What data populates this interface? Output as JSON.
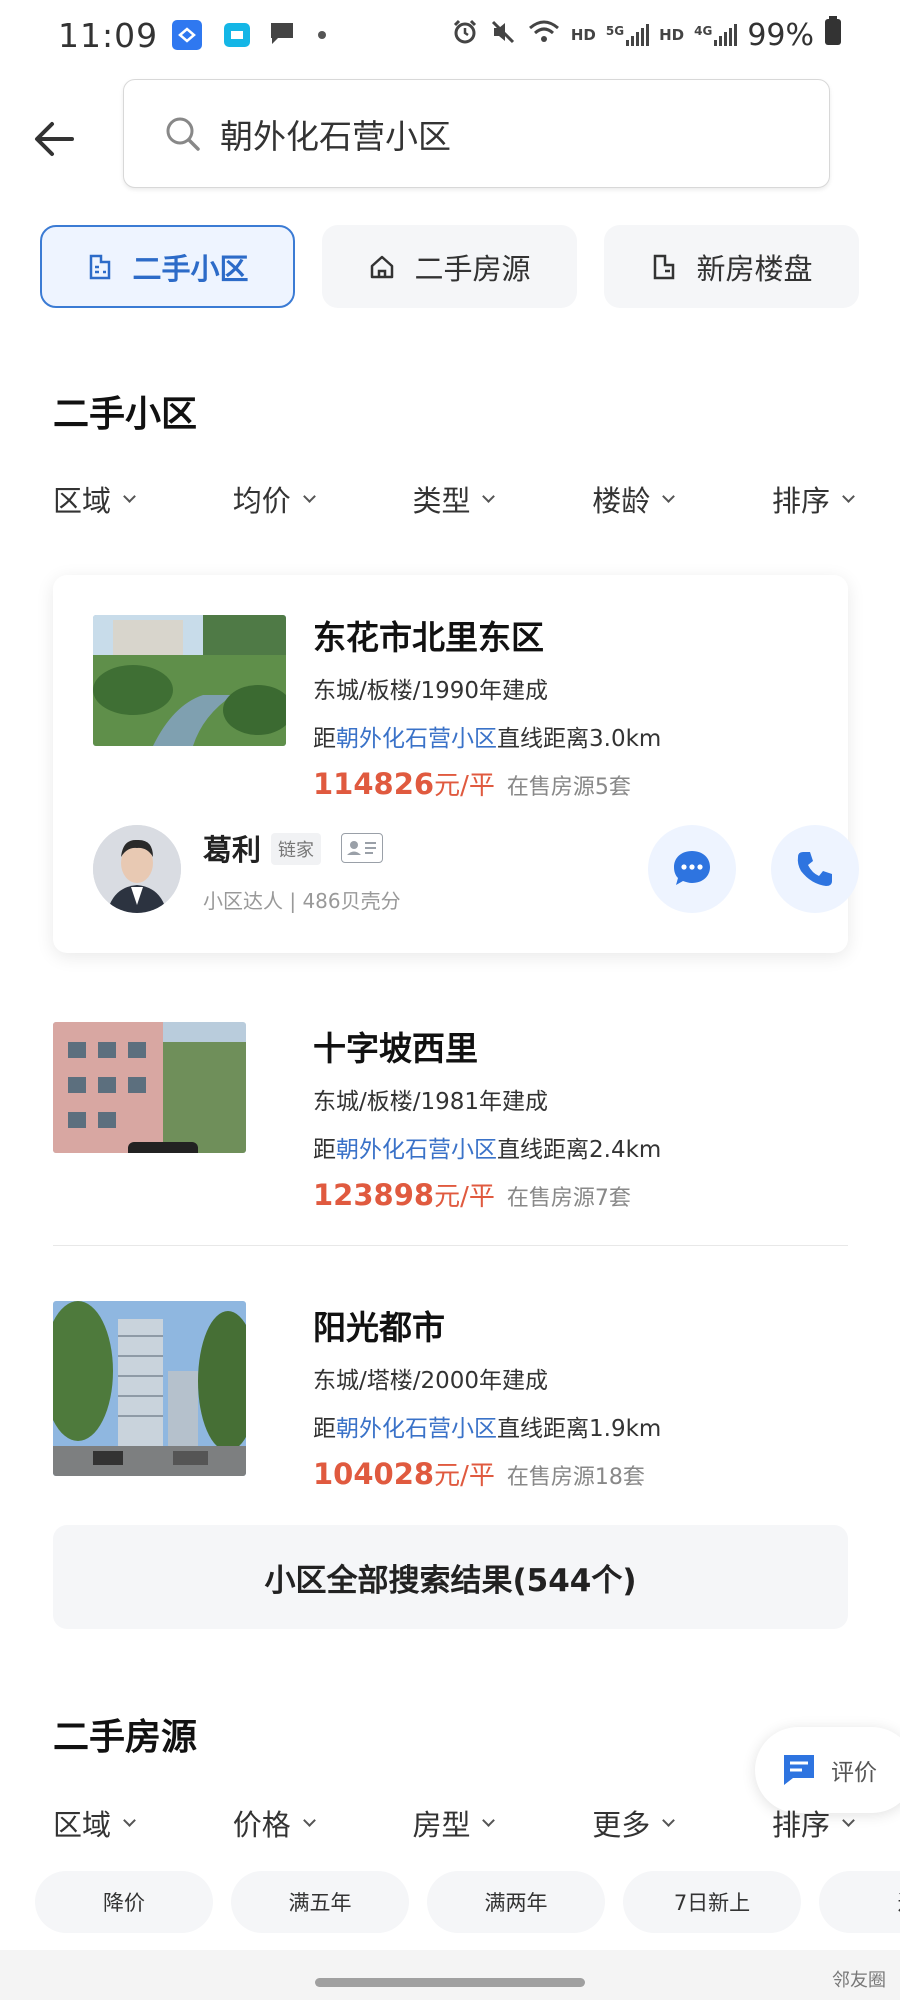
{
  "status_bar": {
    "time": "11:09",
    "hd1": "HD",
    "net1": "5G",
    "hd2": "HD",
    "net2": "4G",
    "battery": "99%"
  },
  "search": {
    "query": "朝外化石营小区"
  },
  "category_tabs": [
    {
      "label": "二手小区",
      "icon": "community-icon",
      "active": true
    },
    {
      "label": "二手房源",
      "icon": "house-icon",
      "active": false
    },
    {
      "label": "新房楼盘",
      "icon": "building-icon",
      "active": false
    }
  ],
  "section_communities": {
    "title": "二手小区",
    "filters": [
      "区域",
      "均价",
      "类型",
      "楼龄",
      "排序"
    ],
    "items": [
      {
        "name": "东花市北里东区",
        "meta": "东城/板楼/1990年建成",
        "dist_prefix": "距",
        "dist_place": "朝外化石营小区",
        "dist_suffix": "直线距离3.0km",
        "price": "114826",
        "price_unit": "元/平",
        "on_sale": "在售房源5套"
      },
      {
        "name": "十字坡西里",
        "meta": "东城/板楼/1981年建成",
        "dist_prefix": "距",
        "dist_place": "朝外化石营小区",
        "dist_suffix": "直线距离2.4km",
        "price": "123898",
        "price_unit": "元/平",
        "on_sale": "在售房源7套"
      },
      {
        "name": "阳光都市",
        "meta": "东城/塔楼/2000年建成",
        "dist_prefix": "距",
        "dist_place": "朝外化石营小区",
        "dist_suffix": "直线距离1.9km",
        "price": "104028",
        "price_unit": "元/平",
        "on_sale": "在售房源18套"
      }
    ],
    "agent": {
      "name": "葛利",
      "badge": "链家",
      "subtitle": "小区达人 | 486贝壳分"
    },
    "all_results": "小区全部搜索结果(544个)"
  },
  "floating_eval": {
    "label": "评价"
  },
  "section_listings": {
    "title": "二手房源",
    "filters": [
      "区域",
      "价格",
      "房型",
      "更多",
      "排序"
    ],
    "chips": [
      "降价",
      "满五年",
      "满两年",
      "7日新上",
      "近"
    ]
  },
  "watermark": "邻友圈",
  "colors": {
    "accent": "#3b7bd4",
    "price": "#e05a3f",
    "link": "#3a72c8"
  }
}
